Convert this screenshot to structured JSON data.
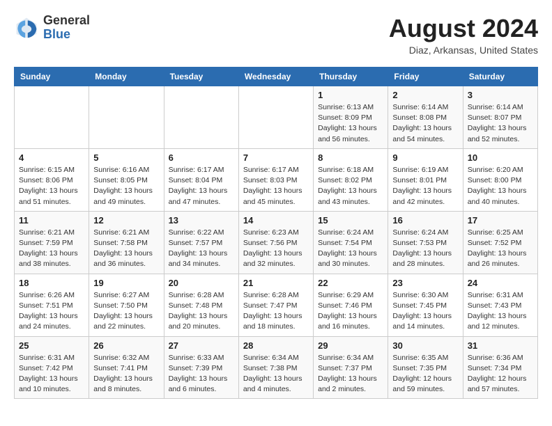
{
  "header": {
    "logo_general": "General",
    "logo_blue": "Blue",
    "month_title": "August 2024",
    "subtitle": "Diaz, Arkansas, United States"
  },
  "days_of_week": [
    "Sunday",
    "Monday",
    "Tuesday",
    "Wednesday",
    "Thursday",
    "Friday",
    "Saturday"
  ],
  "weeks": [
    [
      {
        "day": "",
        "info": ""
      },
      {
        "day": "",
        "info": ""
      },
      {
        "day": "",
        "info": ""
      },
      {
        "day": "",
        "info": ""
      },
      {
        "day": "1",
        "info": "Sunrise: 6:13 AM\nSunset: 8:09 PM\nDaylight: 13 hours\nand 56 minutes."
      },
      {
        "day": "2",
        "info": "Sunrise: 6:14 AM\nSunset: 8:08 PM\nDaylight: 13 hours\nand 54 minutes."
      },
      {
        "day": "3",
        "info": "Sunrise: 6:14 AM\nSunset: 8:07 PM\nDaylight: 13 hours\nand 52 minutes."
      }
    ],
    [
      {
        "day": "4",
        "info": "Sunrise: 6:15 AM\nSunset: 8:06 PM\nDaylight: 13 hours\nand 51 minutes."
      },
      {
        "day": "5",
        "info": "Sunrise: 6:16 AM\nSunset: 8:05 PM\nDaylight: 13 hours\nand 49 minutes."
      },
      {
        "day": "6",
        "info": "Sunrise: 6:17 AM\nSunset: 8:04 PM\nDaylight: 13 hours\nand 47 minutes."
      },
      {
        "day": "7",
        "info": "Sunrise: 6:17 AM\nSunset: 8:03 PM\nDaylight: 13 hours\nand 45 minutes."
      },
      {
        "day": "8",
        "info": "Sunrise: 6:18 AM\nSunset: 8:02 PM\nDaylight: 13 hours\nand 43 minutes."
      },
      {
        "day": "9",
        "info": "Sunrise: 6:19 AM\nSunset: 8:01 PM\nDaylight: 13 hours\nand 42 minutes."
      },
      {
        "day": "10",
        "info": "Sunrise: 6:20 AM\nSunset: 8:00 PM\nDaylight: 13 hours\nand 40 minutes."
      }
    ],
    [
      {
        "day": "11",
        "info": "Sunrise: 6:21 AM\nSunset: 7:59 PM\nDaylight: 13 hours\nand 38 minutes."
      },
      {
        "day": "12",
        "info": "Sunrise: 6:21 AM\nSunset: 7:58 PM\nDaylight: 13 hours\nand 36 minutes."
      },
      {
        "day": "13",
        "info": "Sunrise: 6:22 AM\nSunset: 7:57 PM\nDaylight: 13 hours\nand 34 minutes."
      },
      {
        "day": "14",
        "info": "Sunrise: 6:23 AM\nSunset: 7:56 PM\nDaylight: 13 hours\nand 32 minutes."
      },
      {
        "day": "15",
        "info": "Sunrise: 6:24 AM\nSunset: 7:54 PM\nDaylight: 13 hours\nand 30 minutes."
      },
      {
        "day": "16",
        "info": "Sunrise: 6:24 AM\nSunset: 7:53 PM\nDaylight: 13 hours\nand 28 minutes."
      },
      {
        "day": "17",
        "info": "Sunrise: 6:25 AM\nSunset: 7:52 PM\nDaylight: 13 hours\nand 26 minutes."
      }
    ],
    [
      {
        "day": "18",
        "info": "Sunrise: 6:26 AM\nSunset: 7:51 PM\nDaylight: 13 hours\nand 24 minutes."
      },
      {
        "day": "19",
        "info": "Sunrise: 6:27 AM\nSunset: 7:50 PM\nDaylight: 13 hours\nand 22 minutes."
      },
      {
        "day": "20",
        "info": "Sunrise: 6:28 AM\nSunset: 7:48 PM\nDaylight: 13 hours\nand 20 minutes."
      },
      {
        "day": "21",
        "info": "Sunrise: 6:28 AM\nSunset: 7:47 PM\nDaylight: 13 hours\nand 18 minutes."
      },
      {
        "day": "22",
        "info": "Sunrise: 6:29 AM\nSunset: 7:46 PM\nDaylight: 13 hours\nand 16 minutes."
      },
      {
        "day": "23",
        "info": "Sunrise: 6:30 AM\nSunset: 7:45 PM\nDaylight: 13 hours\nand 14 minutes."
      },
      {
        "day": "24",
        "info": "Sunrise: 6:31 AM\nSunset: 7:43 PM\nDaylight: 13 hours\nand 12 minutes."
      }
    ],
    [
      {
        "day": "25",
        "info": "Sunrise: 6:31 AM\nSunset: 7:42 PM\nDaylight: 13 hours\nand 10 minutes."
      },
      {
        "day": "26",
        "info": "Sunrise: 6:32 AM\nSunset: 7:41 PM\nDaylight: 13 hours\nand 8 minutes."
      },
      {
        "day": "27",
        "info": "Sunrise: 6:33 AM\nSunset: 7:39 PM\nDaylight: 13 hours\nand 6 minutes."
      },
      {
        "day": "28",
        "info": "Sunrise: 6:34 AM\nSunset: 7:38 PM\nDaylight: 13 hours\nand 4 minutes."
      },
      {
        "day": "29",
        "info": "Sunrise: 6:34 AM\nSunset: 7:37 PM\nDaylight: 13 hours\nand 2 minutes."
      },
      {
        "day": "30",
        "info": "Sunrise: 6:35 AM\nSunset: 7:35 PM\nDaylight: 12 hours\nand 59 minutes."
      },
      {
        "day": "31",
        "info": "Sunrise: 6:36 AM\nSunset: 7:34 PM\nDaylight: 12 hours\nand 57 minutes."
      }
    ]
  ]
}
